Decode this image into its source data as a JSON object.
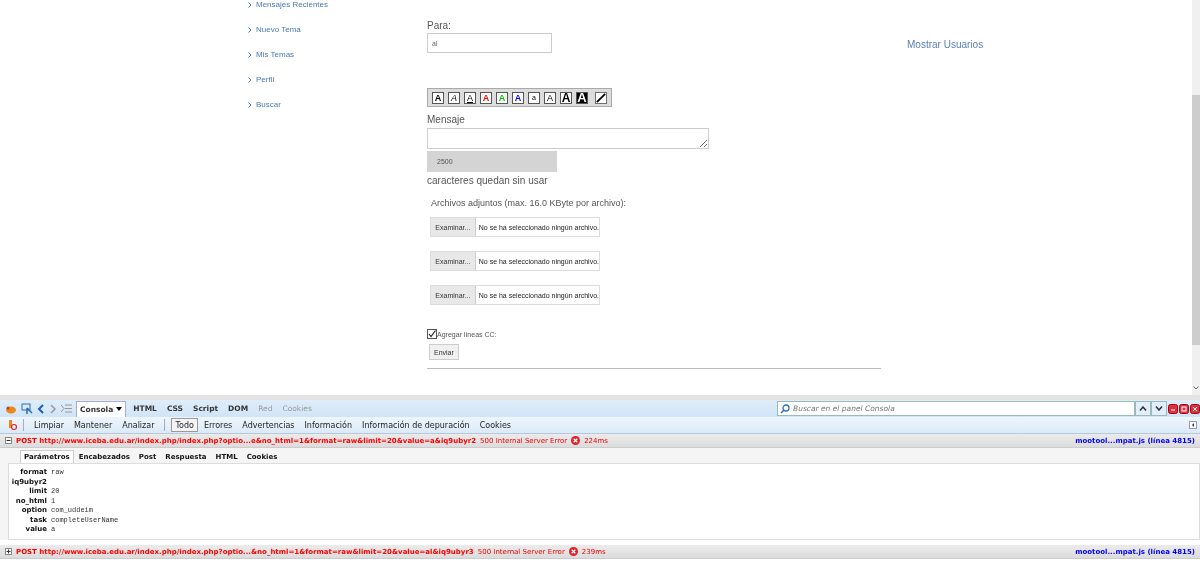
{
  "sidebar": {
    "items": [
      {
        "label": "Mensajes Recientes"
      },
      {
        "label": "Nuevo Tema"
      },
      {
        "label": "Mis Temas"
      },
      {
        "label": "Perfil"
      },
      {
        "label": "Buscar"
      }
    ]
  },
  "form": {
    "to_label": "Para:",
    "to_value": "al",
    "show_users_link": "Mostrar Usuarios",
    "format_buttons": [
      {
        "kind": "bold",
        "label": "A"
      },
      {
        "kind": "italic",
        "label": "A"
      },
      {
        "kind": "underline",
        "label": "A"
      },
      {
        "kind": "color",
        "label": "A",
        "color": "#ff0000"
      },
      {
        "kind": "color",
        "label": "A",
        "color": "#00c000"
      },
      {
        "kind": "color",
        "label": "A",
        "color": "#0000ff"
      },
      {
        "kind": "size-small",
        "label": "a"
      },
      {
        "kind": "size-normal",
        "label": "A"
      },
      {
        "kind": "size-large",
        "label": "A"
      },
      {
        "kind": "size-huge",
        "label": "A"
      },
      {
        "kind": "slash"
      }
    ],
    "message_label": "Mensaje",
    "counter": "2500",
    "counter_note": "caracteres quedan sin usar",
    "attachments_label": "Archivos adjuntos (max. 16.0 KByte por archivo):",
    "file_inputs": [
      {
        "button": "Examinar...",
        "status": "No se ha seleccionado ningún archivo."
      },
      {
        "button": "Examinar...",
        "status": "No se ha seleccionado ningún archivo."
      },
      {
        "button": "Examinar...",
        "status": "No se ha seleccionado ningún archivo."
      }
    ],
    "cc": {
      "label": "Agregar líneas CC:",
      "checked": true
    },
    "submit": "Enviar"
  },
  "devtools": {
    "panel_tabs": [
      {
        "label": "Consola",
        "selected": true,
        "disabled": false
      },
      {
        "label": "HTML",
        "selected": false,
        "disabled": false
      },
      {
        "label": "CSS",
        "selected": false,
        "disabled": false
      },
      {
        "label": "Script",
        "selected": false,
        "disabled": false
      },
      {
        "label": "DOM",
        "selected": false,
        "disabled": false
      },
      {
        "label": "Red",
        "selected": false,
        "disabled": true
      },
      {
        "label": "Cookies",
        "selected": false,
        "disabled": true
      }
    ],
    "search": {
      "placeholder": "Buscar en el panel Consola"
    },
    "console_actions": [
      "Limpiar",
      "Mantener",
      "Analizar"
    ],
    "filters": [
      {
        "label": "Todo",
        "selected": true
      },
      {
        "label": "Errores",
        "selected": false
      },
      {
        "label": "Advertencias",
        "selected": false
      },
      {
        "label": "Información",
        "selected": false
      },
      {
        "label": "Información de depuración",
        "selected": false
      },
      {
        "label": "Cookies",
        "selected": false
      }
    ],
    "requests": [
      {
        "expanded": true,
        "method": "POST",
        "url": "http://www.iceba.edu.ar/index.php/index.php?optio...e&no_html=1&format=raw&limit=20&value=a&iq9ubyr2",
        "status": "500 Internal Server Error",
        "time": "224ms",
        "source": "mootool...mpat.js (línea 4815)",
        "detail_tabs": [
          {
            "label": "Parámetros",
            "selected": true
          },
          {
            "label": "Encabezados",
            "selected": false
          },
          {
            "label": "Post",
            "selected": false
          },
          {
            "label": "Respuesta",
            "selected": false
          },
          {
            "label": "HTML",
            "selected": false
          },
          {
            "label": "Cookies",
            "selected": false
          }
        ],
        "params": [
          {
            "name": "format",
            "value": "raw"
          },
          {
            "name": "iq9ubyr2"
          },
          {
            "name": "limit",
            "value": "20"
          },
          {
            "name": "no_html",
            "value": "1"
          },
          {
            "name": "option",
            "value": "com_uddeim"
          },
          {
            "name": "task",
            "value": "completeUserName"
          },
          {
            "name": "value",
            "value": "a"
          }
        ]
      },
      {
        "expanded": false,
        "method": "POST",
        "url": "http://www.iceba.edu.ar/index.php/index.php?optio...&no_html=1&format=raw&limit=20&value=al&iq9ubyr3",
        "status": "500 Internal Server Error",
        "time": "239ms",
        "source": "mootool...mpat.js (línea 4815)"
      }
    ]
  }
}
